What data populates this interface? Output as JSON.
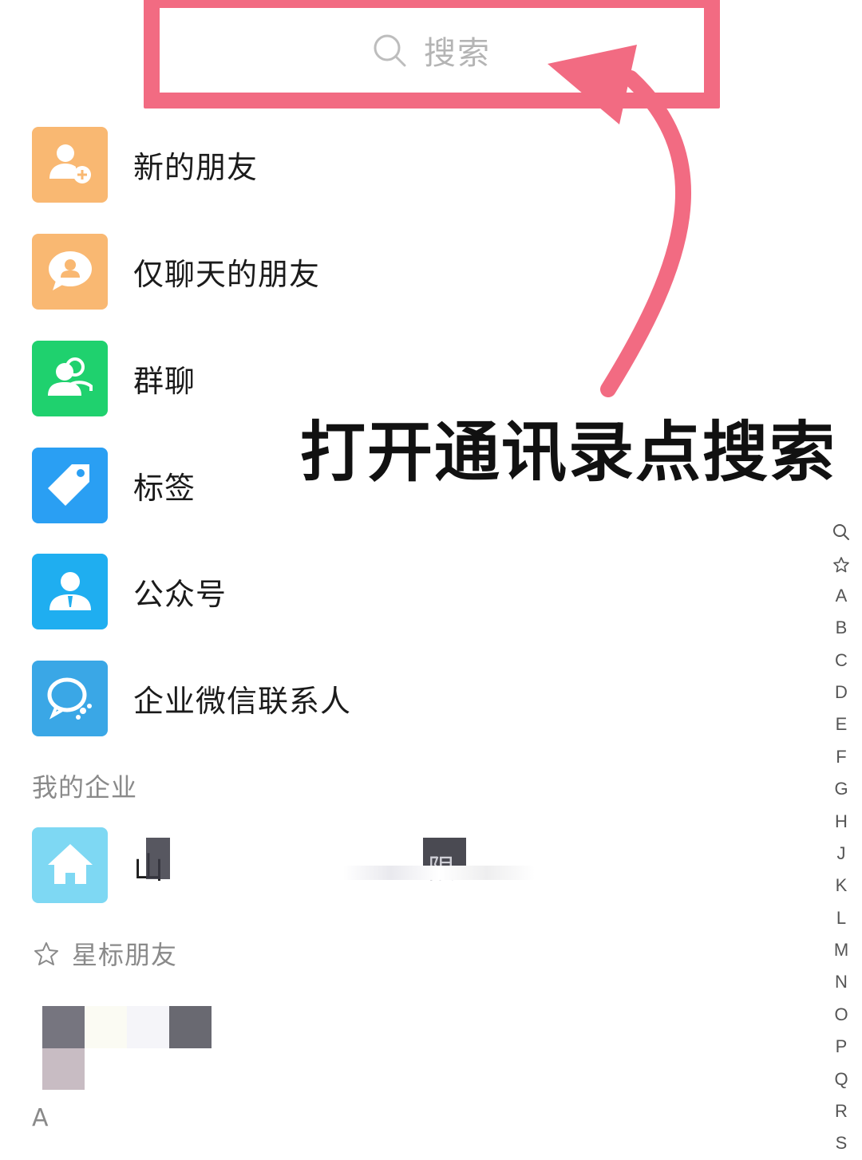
{
  "search": {
    "placeholder": "搜索",
    "icon": "search-icon"
  },
  "menu": [
    {
      "label": "新的朋友",
      "icon": "add-friend-icon",
      "color": "#f9b872"
    },
    {
      "label": "仅聊天的朋友",
      "icon": "chat-friend-icon",
      "color": "#f9b872"
    },
    {
      "label": "群聊",
      "icon": "group-chat-icon",
      "color": "#1fd16e"
    },
    {
      "label": "标签",
      "icon": "tag-icon",
      "color": "#2a9ff3"
    },
    {
      "label": "公众号",
      "icon": "official-account-icon",
      "color": "#1faef0"
    },
    {
      "label": "企业微信联系人",
      "icon": "wecom-contact-icon",
      "color": "#3aa7e6"
    }
  ],
  "enterprise": {
    "section_title": "我的企业",
    "item": {
      "label": "山",
      "icon": "home-icon",
      "color": "#7ed8f3",
      "visible_fragment": "限"
    }
  },
  "starred": {
    "section_title": "星标朋友",
    "icon": "star-icon"
  },
  "letter_section": {
    "title": "A"
  },
  "annotation": {
    "text": "打开通讯录点搜索",
    "arrow_color": "#f26b82"
  },
  "index_bar": [
    "search-icon",
    "star-icon",
    "A",
    "B",
    "C",
    "D",
    "E",
    "F",
    "G",
    "H",
    "J",
    "K",
    "L",
    "M",
    "N",
    "O",
    "P",
    "Q",
    "R",
    "S"
  ],
  "colors": {
    "highlight": "#f26b82",
    "section_text": "#8a8a8a",
    "placeholder": "#b4b4b4"
  }
}
